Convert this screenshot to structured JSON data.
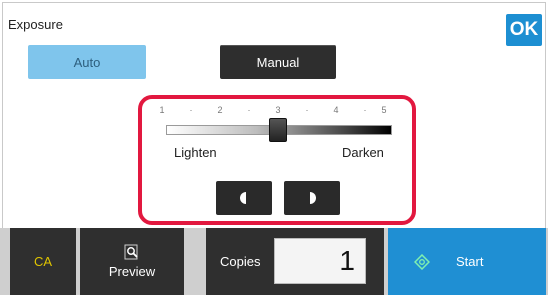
{
  "header": {
    "title": "Exposure",
    "ok_label": "OK"
  },
  "mode": {
    "auto_label": "Auto",
    "manual_label": "Manual",
    "selected": "Manual"
  },
  "slider": {
    "scale_labels": [
      "1",
      "·",
      "2",
      "·",
      "3",
      "·",
      "4",
      "·",
      "5"
    ],
    "value": 3,
    "min": 1,
    "max": 5,
    "left_label": "Lighten",
    "right_label": "Darken"
  },
  "steppers": {
    "lighter_icon": "half-moon-left-icon",
    "darker_icon": "half-moon-right-icon"
  },
  "footer": {
    "ca_label": "CA",
    "preview_label": "Preview",
    "preview_icon": "magnifier-icon",
    "copies_label": "Copies",
    "copies_value": "1",
    "start_label": "Start",
    "start_icon": "diamond-start-icon"
  },
  "colors": {
    "accent_blue": "#1d8fd2",
    "highlight_red": "#e2183f",
    "auto_bg": "#7fc5ec",
    "dark_button": "#2e2e2e",
    "ca_text": "#e0c500"
  }
}
